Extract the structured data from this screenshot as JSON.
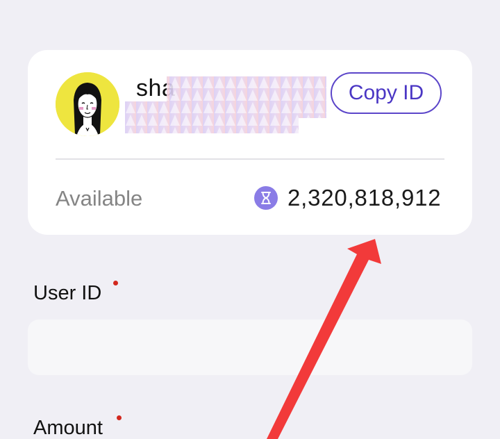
{
  "account_card": {
    "username_visible": "sha",
    "copy_button_label": "Copy ID",
    "available_label": "Available",
    "balance": "2,320,818,912",
    "coin_icon": "hourglass-coin-icon"
  },
  "form": {
    "user_id_label": "User ID",
    "user_id_value": "",
    "amount_label": "Amount"
  },
  "colors": {
    "accent": "#4a36c4",
    "required_dot": "#d2281e",
    "annotation_arrow": "#f23a3a",
    "avatar_bg": "#eee53f"
  }
}
